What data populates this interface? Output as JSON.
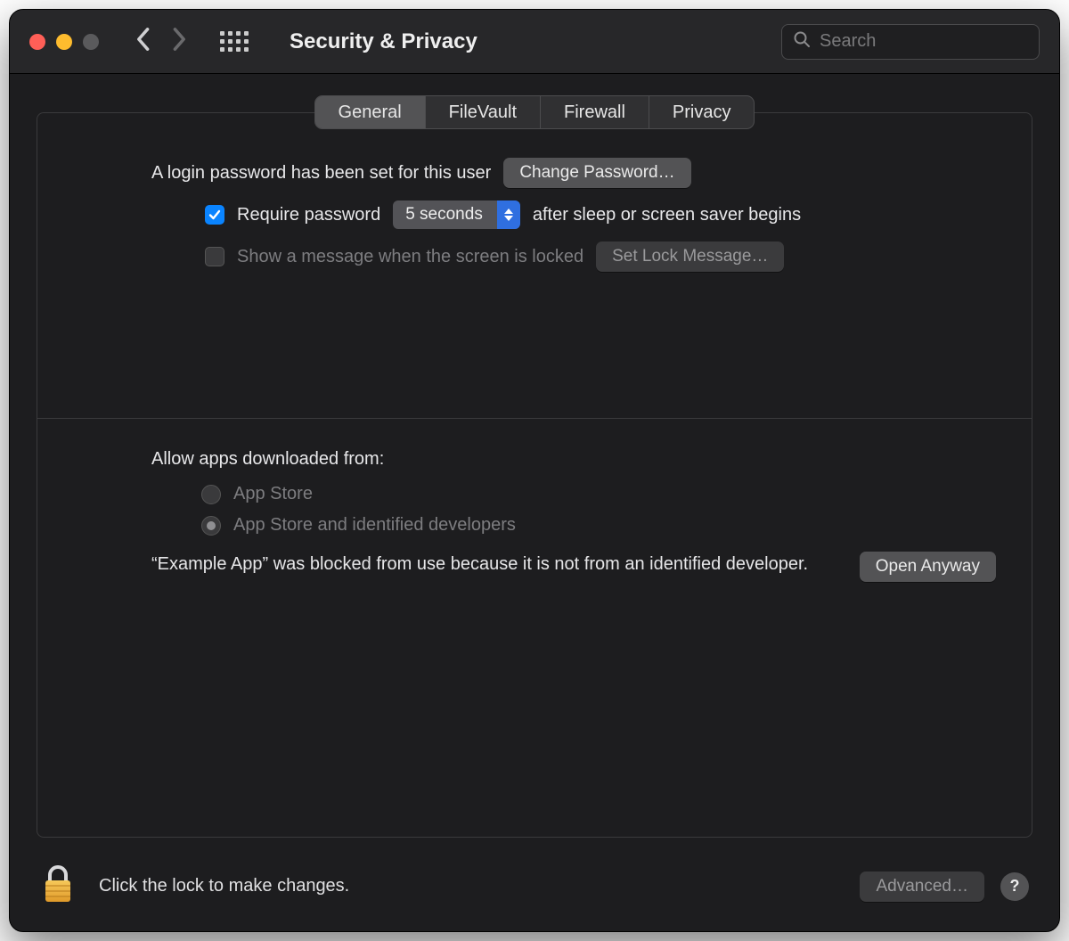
{
  "window": {
    "title": "Security & Privacy"
  },
  "search": {
    "placeholder": "Search"
  },
  "tabs": [
    {
      "label": "General",
      "active": true
    },
    {
      "label": "FileVault",
      "active": false
    },
    {
      "label": "Firewall",
      "active": false
    },
    {
      "label": "Privacy",
      "active": false
    }
  ],
  "login": {
    "status_text": "A login password has been set for this user",
    "change_button": "Change Password…",
    "require_checked": true,
    "require_prefix": "Require password",
    "require_delay_value": "5 seconds",
    "require_suffix": "after sleep or screen saver begins",
    "show_message_checked": false,
    "show_message_label": "Show a message when the screen is locked",
    "set_lock_message_button": "Set Lock Message…"
  },
  "allow": {
    "heading": "Allow apps downloaded from:",
    "options": [
      {
        "label": "App Store",
        "selected": false
      },
      {
        "label": "App Store and identified developers",
        "selected": true
      }
    ],
    "blocked_message": "“Example App” was blocked from use because it is not from an identified developer.",
    "open_anyway": "Open Anyway"
  },
  "footer": {
    "hint": "Click the lock to make changes.",
    "advanced": "Advanced…",
    "help": "?"
  }
}
